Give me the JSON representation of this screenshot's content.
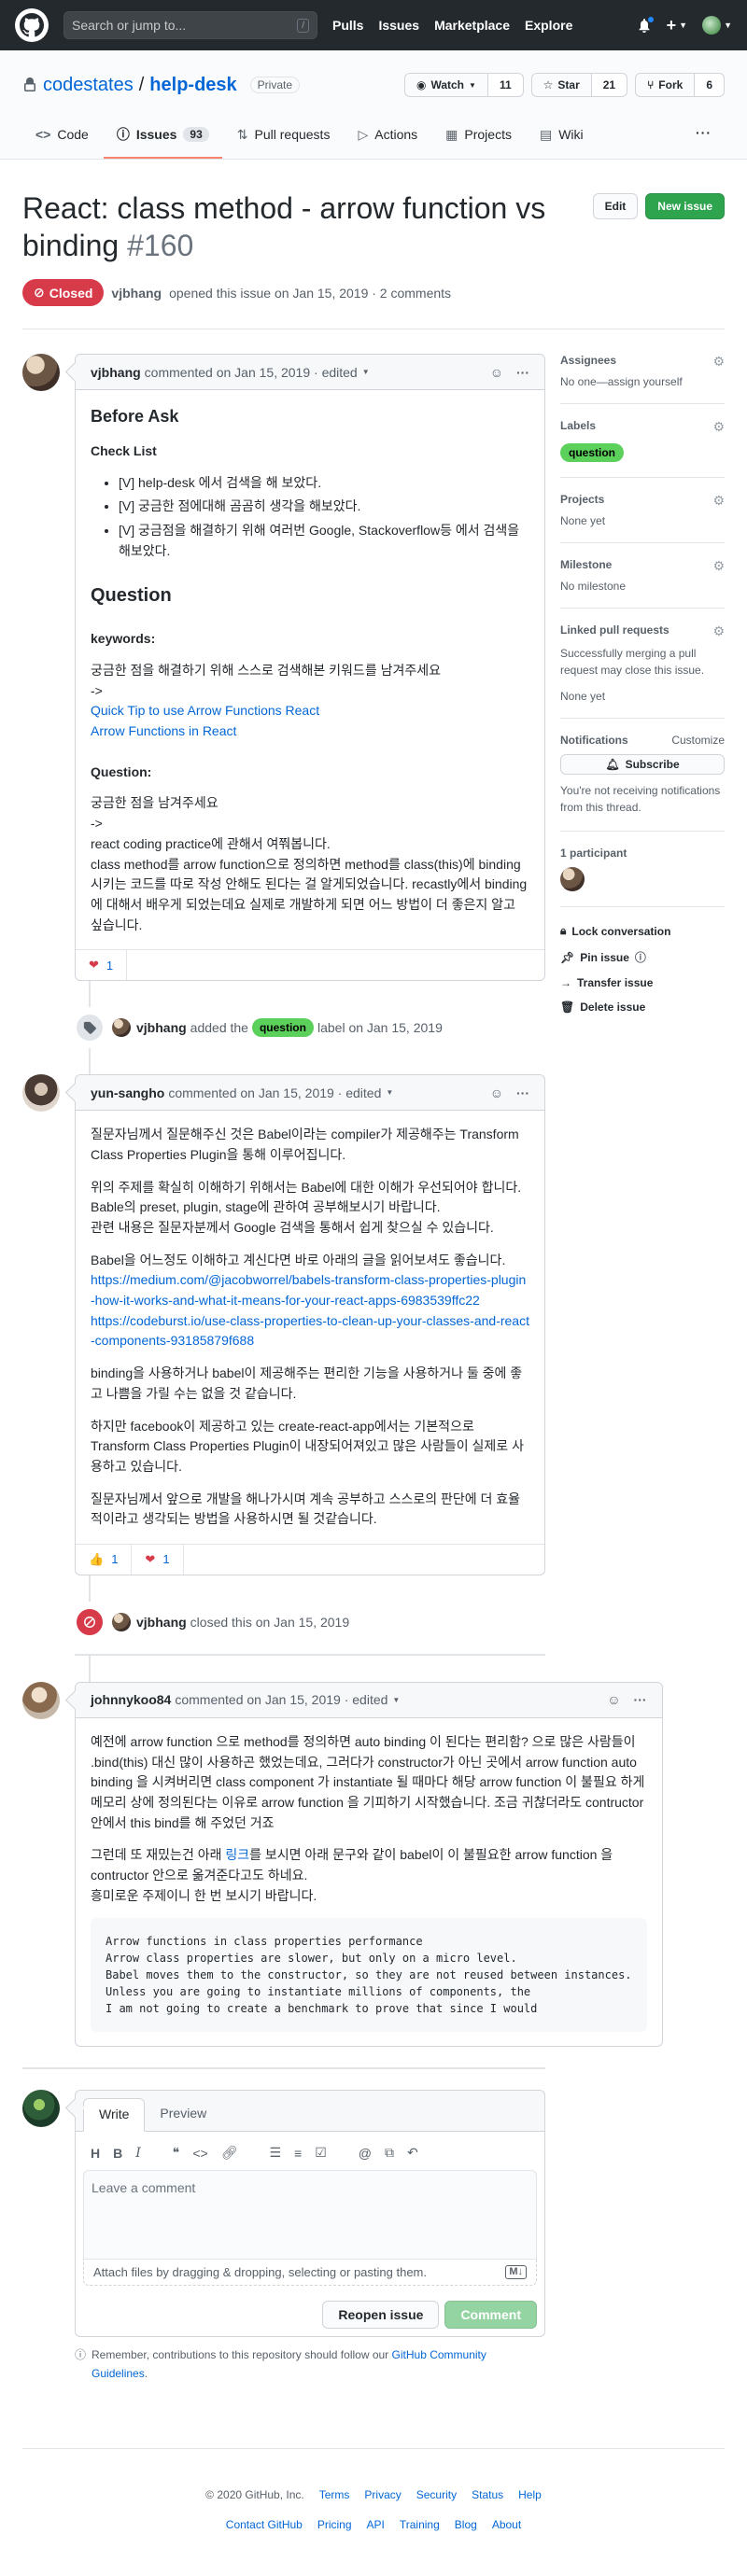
{
  "topnav": {
    "search_placeholder": "Search or jump to...",
    "slash": "/",
    "links": [
      "Pulls",
      "Issues",
      "Marketplace",
      "Explore"
    ],
    "plus": "+"
  },
  "repo": {
    "owner": "codestates",
    "separator": "/",
    "name": "help-desk",
    "visibility": "Private",
    "watch_label": "Watch",
    "watch_count": "11",
    "star_label": "Star",
    "star_count": "21",
    "fork_label": "Fork",
    "fork_count": "6",
    "nav": {
      "code": "Code",
      "issues": "Issues",
      "issues_count": "93",
      "pulls": "Pull requests",
      "actions": "Actions",
      "projects": "Projects",
      "wiki": "Wiki",
      "more": "···"
    }
  },
  "issue": {
    "title": "React: class method - arrow function vs binding",
    "number": "#160",
    "state": "Closed",
    "edit_label": "Edit",
    "new_issue_label": "New issue",
    "author": "vjbhang",
    "meta": "opened this issue on Jan 15, 2019 · 2 comments"
  },
  "comments": [
    {
      "author": "vjbhang",
      "meta": "commented on Jan 15, 2019 · edited",
      "before_ask": "Before Ask",
      "checklist_title": "Check List",
      "checklist": [
        "[V] help-desk 에서 검색을 해 보았다.",
        "[V] 궁금한 점에대해 곰곰히 생각을 해보았다.",
        "[V] 궁금점을 해결하기 위해 여러번 Google, Stackoverflow등 에서 검색을 해보았다."
      ],
      "question_heading": "Question",
      "keywords_title": "keywords:",
      "keywords_text": "궁금한 점을 해결하기 위해 스스로 검색해본 키워드를 남겨주세요",
      "arrow": "->",
      "link1": "Quick Tip to use Arrow Functions React",
      "link2": "Arrow Functions in React",
      "question_title": "Question:",
      "question_text": "궁금한 점을 남겨주세요",
      "question_line1": "react coding practice에 관해서 여쭤봅니다.",
      "question_line2": "class method를 arrow function으로 정의하면 method를 class(this)에 binding시키는 코드를 따로 작성 안해도 된다는 걸 알게되었습니다. recastly에서 binding에 대해서 배우게 되었는데요 실제로 개발하게 되면 어느 방법이 더 좋은지 알고 싶습니다.",
      "reaction_count": "1"
    },
    {
      "author": "yun-sangho",
      "meta": "commented on Jan 15, 2019 · edited",
      "p1": "질문자님께서 질문해주신 것은 Babel이라는 compiler가 제공해주는 Transform Class Properties Plugin을 통해 이루어집니다.",
      "p2a": "위의 주제를 확실히 이해하기 위해서는 Babel에 대한 이해가 우선되어야 합니다.",
      "p2b": "Bable의 preset, plugin, stage에 관하여 공부해보시기 바랍니다.",
      "p2c": "관련 내용은 질문자분께서 Google 검색을 통해서 쉽게 찾으실 수 있습니다.",
      "p3": "Babel을 어느정도 이해하고 계신다면 바로 아래의 글을 읽어보셔도 좋습니다.",
      "link1": "https://medium.com/@jacobworrel/babels-transform-class-properties-plugin-how-it-works-and-what-it-means-for-your-react-apps-6983539ffc22",
      "link2": "https://codeburst.io/use-class-properties-to-clean-up-your-classes-and-react-components-93185879f688",
      "p4": "binding을 사용하거나 babel이 제공해주는 편리한 기능을 사용하거나 둘 중에 좋고 나쁨을 가릴 수는 없을 것 같습니다.",
      "p5": "하지만 facebook이 제공하고 있는 create-react-app에서는 기본적으로 Transform Class Properties Plugin이 내장되어져있고 많은 사람들이 실제로 사용하고 있습니다.",
      "p6": "질문자님께서 앞으로 개발을 해나가시며 계속 공부하고 스스로의 판단에 더 효율적이라고 생각되는 방법을 사용하시면 될 것같습니다.",
      "thumbs_count": "1",
      "heart_count": "1"
    },
    {
      "author": "johnnykoo84",
      "meta": "commented on Jan 15, 2019 · edited",
      "p1": "예전에 arrow function 으로 method를 정의하면 auto binding 이 된다는 편리함? 으로 많은 사람들이 .bind(this) 대신 많이 사용하곤 했었는데요, 그러다가 constructor가 아닌 곳에서 arrow function auto binding 을 시켜버리면 class component 가 instantiate 될 때마다 해당 arrow function 이 불필요 하게 메모리 상에 정의된다는 이유로 arrow function 을 기피하기 시작했습니다. 조금 귀찮더라도 contructor안에서 this bind를 해 주었던 거죠",
      "p2_before": "그런데 또 재밌는건 아래 ",
      "p2_link": "링크",
      "p2_after": "를 보시면 아래 문구와 같이 babel이 이 불필요한 arrow function 을 contructor 안으로 옮겨준다고도 하네요.",
      "p3": "흥미로운 주제이니 한 번 보시기 바랍니다.",
      "code": "Arrow functions in class properties performance\nArrow class properties are slower, but only on a micro level.\nBabel moves them to the constructor, so they are not reused between instances.\nUnless you are going to instantiate millions of components, the\nI am not going to create a benchmark to prove that since I would"
    }
  ],
  "events": {
    "labeled_author": "vjbhang",
    "labeled_before": "added the",
    "labeled_label": "question",
    "labeled_after": "label on Jan 15, 2019",
    "closed_author": "vjbhang",
    "closed_text": "closed this on Jan 15, 2019"
  },
  "new_comment": {
    "tab_write": "Write",
    "tab_preview": "Preview",
    "placeholder": "Leave a comment",
    "attach_text": "Attach files by dragging & dropping, selecting or pasting them.",
    "reopen_label": "Reopen issue",
    "comment_label": "Comment",
    "guidelines_before": "Remember, contributions to this repository should follow our",
    "guidelines_link": "GitHub Community Guidelines",
    "guidelines_after": "."
  },
  "sidebar": {
    "assignees_title": "Assignees",
    "assignees_value": "No one—assign yourself",
    "labels_title": "Labels",
    "label_value": "question",
    "projects_title": "Projects",
    "projects_value": "None yet",
    "milestone_title": "Milestone",
    "milestone_value": "No milestone",
    "linked_title": "Linked pull requests",
    "linked_desc": "Successfully merging a pull request may close this issue.",
    "linked_value": "None yet",
    "notifications_title": "Notifications",
    "customize": "Customize",
    "subscribe": "Subscribe",
    "notifications_desc": "You're not receiving notifications from this thread.",
    "participants_title": "1 participant",
    "lock": "Lock conversation",
    "pin": "Pin issue",
    "transfer": "Transfer issue",
    "delete": "Delete issue"
  },
  "footer": {
    "copyright": "© 2020 GitHub, Inc.",
    "row1": [
      "Terms",
      "Privacy",
      "Security",
      "Status",
      "Help"
    ],
    "row2": [
      "Contact GitHub",
      "Pricing",
      "API",
      "Training",
      "Blog",
      "About"
    ]
  },
  "colors": {
    "closed": "#d73a49",
    "primary": "#2ea44f",
    "link": "#0366d6",
    "label_question": "#5bd05b",
    "nav_underline": "#f9826c"
  }
}
